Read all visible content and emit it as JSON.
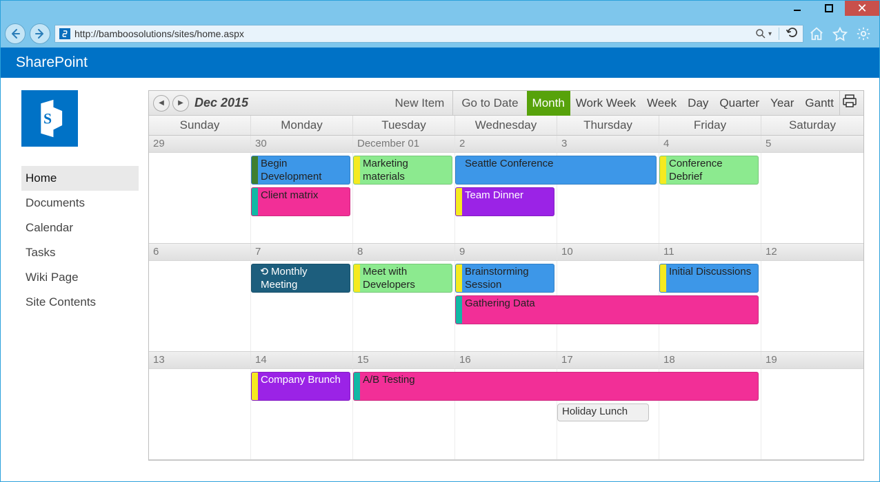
{
  "browser": {
    "url": "http://bamboosolutions/sites/home.aspx"
  },
  "suite": {
    "name": "SharePoint"
  },
  "leftnav": {
    "items": [
      "Home",
      "Documents",
      "Calendar",
      "Tasks",
      "Wiki Page",
      "Site Contents"
    ],
    "active": 0
  },
  "toolbar": {
    "monthLabel": "Dec 2015",
    "newItem": "New Item",
    "gotoDate": "Go to Date",
    "views": [
      "Month",
      "Work Week",
      "Week",
      "Day",
      "Quarter",
      "Year",
      "Gantt"
    ],
    "activeView": 0
  },
  "dayHeaders": [
    "Sunday",
    "Monday",
    "Tuesday",
    "Wednesday",
    "Thursday",
    "Friday",
    "Saturday"
  ],
  "weeks": [
    {
      "dates": [
        "29",
        "30",
        "December 01",
        "2",
        "3",
        "4",
        "5"
      ]
    },
    {
      "dates": [
        "6",
        "7",
        "8",
        "9",
        "10",
        "11",
        "12"
      ]
    },
    {
      "dates": [
        "13",
        "14",
        "15",
        "16",
        "17",
        "18",
        "19"
      ]
    }
  ],
  "events": {
    "w0": [
      {
        "label": "Begin Development",
        "startCol": 1,
        "span": 1,
        "row": 0,
        "body": "c-blue",
        "bar": "c-darkgreen"
      },
      {
        "label": "Marketing materials",
        "startCol": 2,
        "span": 1,
        "row": 0,
        "body": "c-green",
        "bar": "c-yellow"
      },
      {
        "label": "Seattle Conference",
        "startCol": 3,
        "span": 2,
        "row": 0,
        "body": "c-blue",
        "bar": "c-blue"
      },
      {
        "label": "Conference Debrief",
        "startCol": 5,
        "span": 1,
        "row": 0,
        "body": "c-green",
        "bar": "c-yellow"
      },
      {
        "label": "Client matrix",
        "startCol": 1,
        "span": 1,
        "row": 1,
        "body": "c-pink",
        "bar": "c-cyan"
      },
      {
        "label": "Team Dinner",
        "startCol": 3,
        "span": 1,
        "row": 1,
        "body": "c-purple",
        "bar": "c-yellow",
        "dark": true
      }
    ],
    "w1": [
      {
        "label": "Monthly Meeting",
        "startCol": 1,
        "span": 1,
        "row": 0,
        "body": "c-navy",
        "bar": "c-navy",
        "dark": true,
        "recurring": true
      },
      {
        "label": "Meet with Developers",
        "startCol": 2,
        "span": 1,
        "row": 0,
        "body": "c-green",
        "bar": "c-yellow"
      },
      {
        "label": "Brainstorming Session",
        "startCol": 3,
        "span": 1,
        "row": 0,
        "body": "c-blue",
        "bar": "c-yellow"
      },
      {
        "label": "Initial Discussions",
        "startCol": 5,
        "span": 1,
        "row": 0,
        "body": "c-blue",
        "bar": "c-yellow"
      },
      {
        "label": "Gathering Data",
        "startCol": 3,
        "span": 3,
        "row": 1,
        "body": "c-pink",
        "bar": "c-cyan"
      }
    ],
    "w2": [
      {
        "label": "Company Brunch",
        "startCol": 1,
        "span": 1,
        "row": 0,
        "body": "c-purple",
        "bar": "c-yellow",
        "dark": true
      },
      {
        "label": "A/B Testing",
        "startCol": 2,
        "span": 4,
        "row": 0,
        "body": "c-pink",
        "bar": "c-cyan"
      },
      {
        "label": "Holiday Lunch",
        "startCol": 4,
        "span": 1,
        "row": 1,
        "small": true
      }
    ]
  }
}
